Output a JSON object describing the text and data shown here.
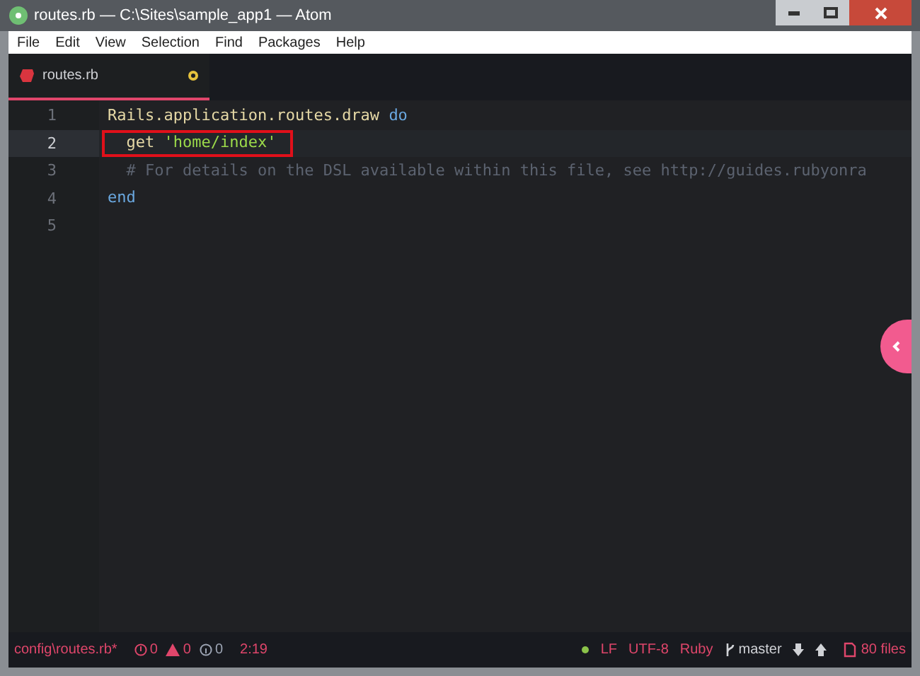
{
  "window": {
    "title": "routes.rb — C:\\Sites\\sample_app1 — Atom"
  },
  "menu": [
    "File",
    "Edit",
    "View",
    "Selection",
    "Find",
    "Packages",
    "Help"
  ],
  "tabs": [
    {
      "label": "routes.rb",
      "selected": true,
      "modified": true
    }
  ],
  "editor": {
    "lines": [
      {
        "number": "1",
        "cursor": false,
        "boxed": false,
        "tokens": [
          {
            "text": "Rails.application.routes.draw ",
            "kind": "plain"
          },
          {
            "text": "do",
            "kind": "keyword"
          }
        ]
      },
      {
        "number": "2",
        "cursor": true,
        "boxed": true,
        "tokens": [
          {
            "text": "  get ",
            "kind": "plain"
          },
          {
            "text": "'home/index'",
            "kind": "string"
          }
        ]
      },
      {
        "number": "3",
        "cursor": false,
        "boxed": false,
        "tokens": [
          {
            "text": "  # For details on the DSL available within this file, see http://guides.rubyonra",
            "kind": "comment"
          }
        ]
      },
      {
        "number": "4",
        "cursor": false,
        "boxed": false,
        "tokens": [
          {
            "text": "end",
            "kind": "keyword"
          }
        ]
      },
      {
        "number": "5",
        "cursor": false,
        "boxed": false
      }
    ]
  },
  "status_bar": {
    "file": "config\\routes.rb*",
    "errors": "0",
    "warnings": "0",
    "infos": "0",
    "position": "2:19",
    "line_ending": "LF",
    "encoding": "UTF-8",
    "grammar": "Ruby",
    "branch": "master",
    "files": "80 files"
  }
}
